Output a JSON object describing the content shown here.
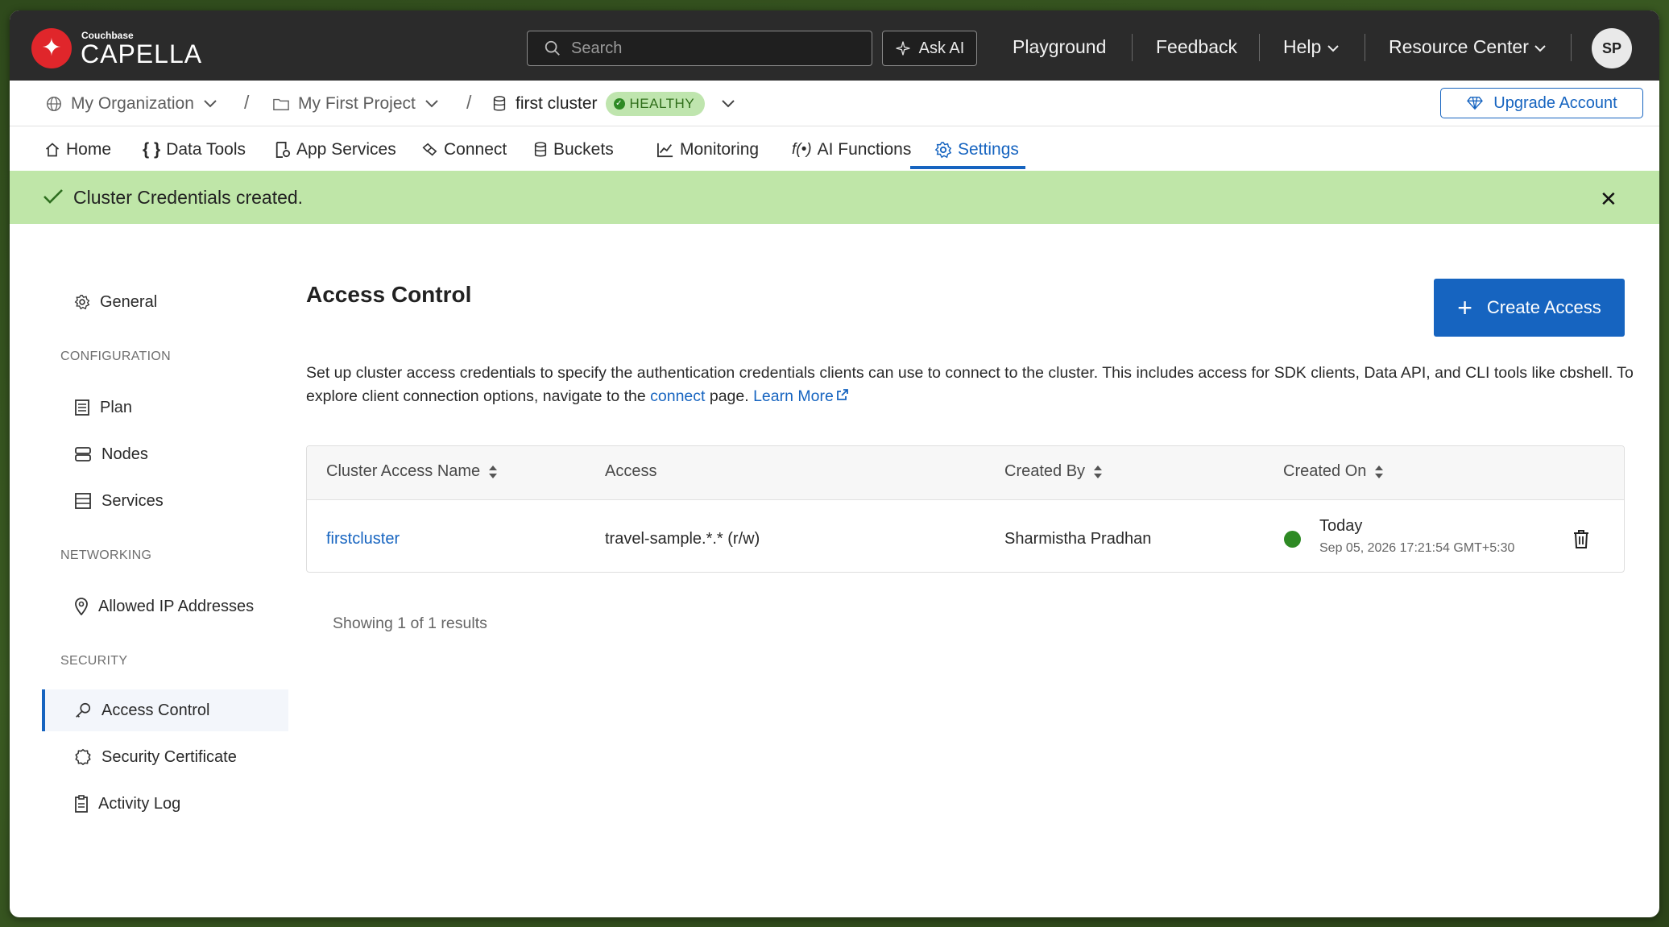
{
  "app": {
    "logo_small": "Couchbase",
    "logo_big": "CAPELLA",
    "search_placeholder": "Search",
    "ask_ai": "Ask AI",
    "nav": [
      "Playground",
      "Feedback",
      "Help",
      "Resource Center"
    ],
    "avatar_initials": "SP"
  },
  "breadcrumb": {
    "organization": "My Organization",
    "project": "My First Project",
    "cluster": "first cluster",
    "status": "HEALTHY",
    "upgrade": "Upgrade Account"
  },
  "tabs": [
    {
      "label": "Home",
      "icon": "home-icon"
    },
    {
      "label": "Data Tools",
      "icon": "braces-icon"
    },
    {
      "label": "App Services",
      "icon": "app-services-icon"
    },
    {
      "label": "Connect",
      "icon": "connect-icon"
    },
    {
      "label": "Buckets",
      "icon": "database-icon"
    },
    {
      "label": "Monitoring",
      "icon": "chart-icon"
    },
    {
      "label": "AI Functions",
      "icon": "function-icon"
    },
    {
      "label": "Settings",
      "icon": "gear-icon",
      "active": true
    }
  ],
  "toast": {
    "message": "Cluster Credentials created.",
    "color": "#bfe6a8"
  },
  "sidebar": {
    "general": "General",
    "sections": [
      {
        "heading": "CONFIGURATION",
        "items": [
          "Plan",
          "Nodes",
          "Services"
        ]
      },
      {
        "heading": "NETWORKING",
        "items": [
          "Allowed IP Addresses"
        ]
      },
      {
        "heading": "SECURITY",
        "items": [
          "Access Control",
          "Security Certificate",
          "Activity Log"
        ]
      }
    ],
    "active": "Access Control"
  },
  "main": {
    "title": "Access Control",
    "create_button": "Create Access",
    "description_part1": "Set up cluster access credentials to specify the authentication credentials clients can use to connect to the cluster. This includes access for SDK clients, Data API, and CLI tools like cbshell. To explore client connection options, navigate to the ",
    "description_link": "connect",
    "description_part2": " page. ",
    "learn_more": "Learn More",
    "table": {
      "columns": [
        "Cluster Access Name",
        "Access",
        "Created By",
        "Created On"
      ],
      "rows": [
        {
          "name": "firstcluster",
          "access": "travel-sample.*.* (r/w)",
          "created_by": "Sharmistha Pradhan",
          "created_on": "Today",
          "created_on_detail": "Sep 05, 2026 17:21:54 GMT+5:30"
        }
      ]
    },
    "results": "Showing 1 of 1 results"
  },
  "colors": {
    "accent": "#1664c0",
    "topbar": "#2b2b2b",
    "healthy": "#2e8a24"
  }
}
